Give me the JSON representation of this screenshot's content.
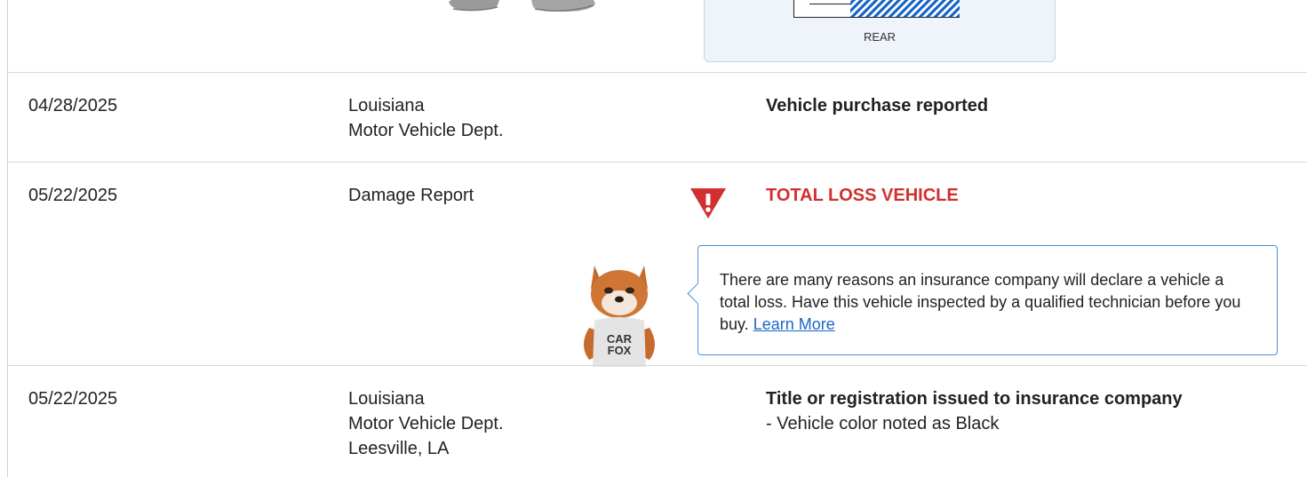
{
  "diagram": {
    "label": "REAR"
  },
  "rows": [
    {
      "date": "04/28/2025",
      "source": [
        "Louisiana",
        "Motor Vehicle Dept."
      ],
      "detail_title": "Vehicle purchase reported"
    },
    {
      "date": "05/22/2025",
      "source": [
        "Damage Report"
      ],
      "detail_title": "TOTAL LOSS VEHICLE",
      "tooltip": {
        "text": "There are many reasons an insurance company will declare a vehicle a total loss. Have this vehicle inspected by a qualified technician before you buy.",
        "link": "Learn More"
      },
      "mascot_shirt": [
        "CAR",
        "FOX"
      ]
    },
    {
      "date": "05/22/2025",
      "source": [
        "Louisiana",
        "Motor Vehicle Dept.",
        "Leesville, LA"
      ],
      "detail_title": "Title or registration issued to insurance company",
      "detail_note": "- Vehicle color noted as Black"
    }
  ],
  "colors": {
    "alert": "#d22f2f",
    "link": "#1a66c8",
    "tooltip_border": "#4a90d9"
  },
  "icons": {
    "warning": "warning-triangle-icon",
    "mascot": "carfox-mascot"
  }
}
